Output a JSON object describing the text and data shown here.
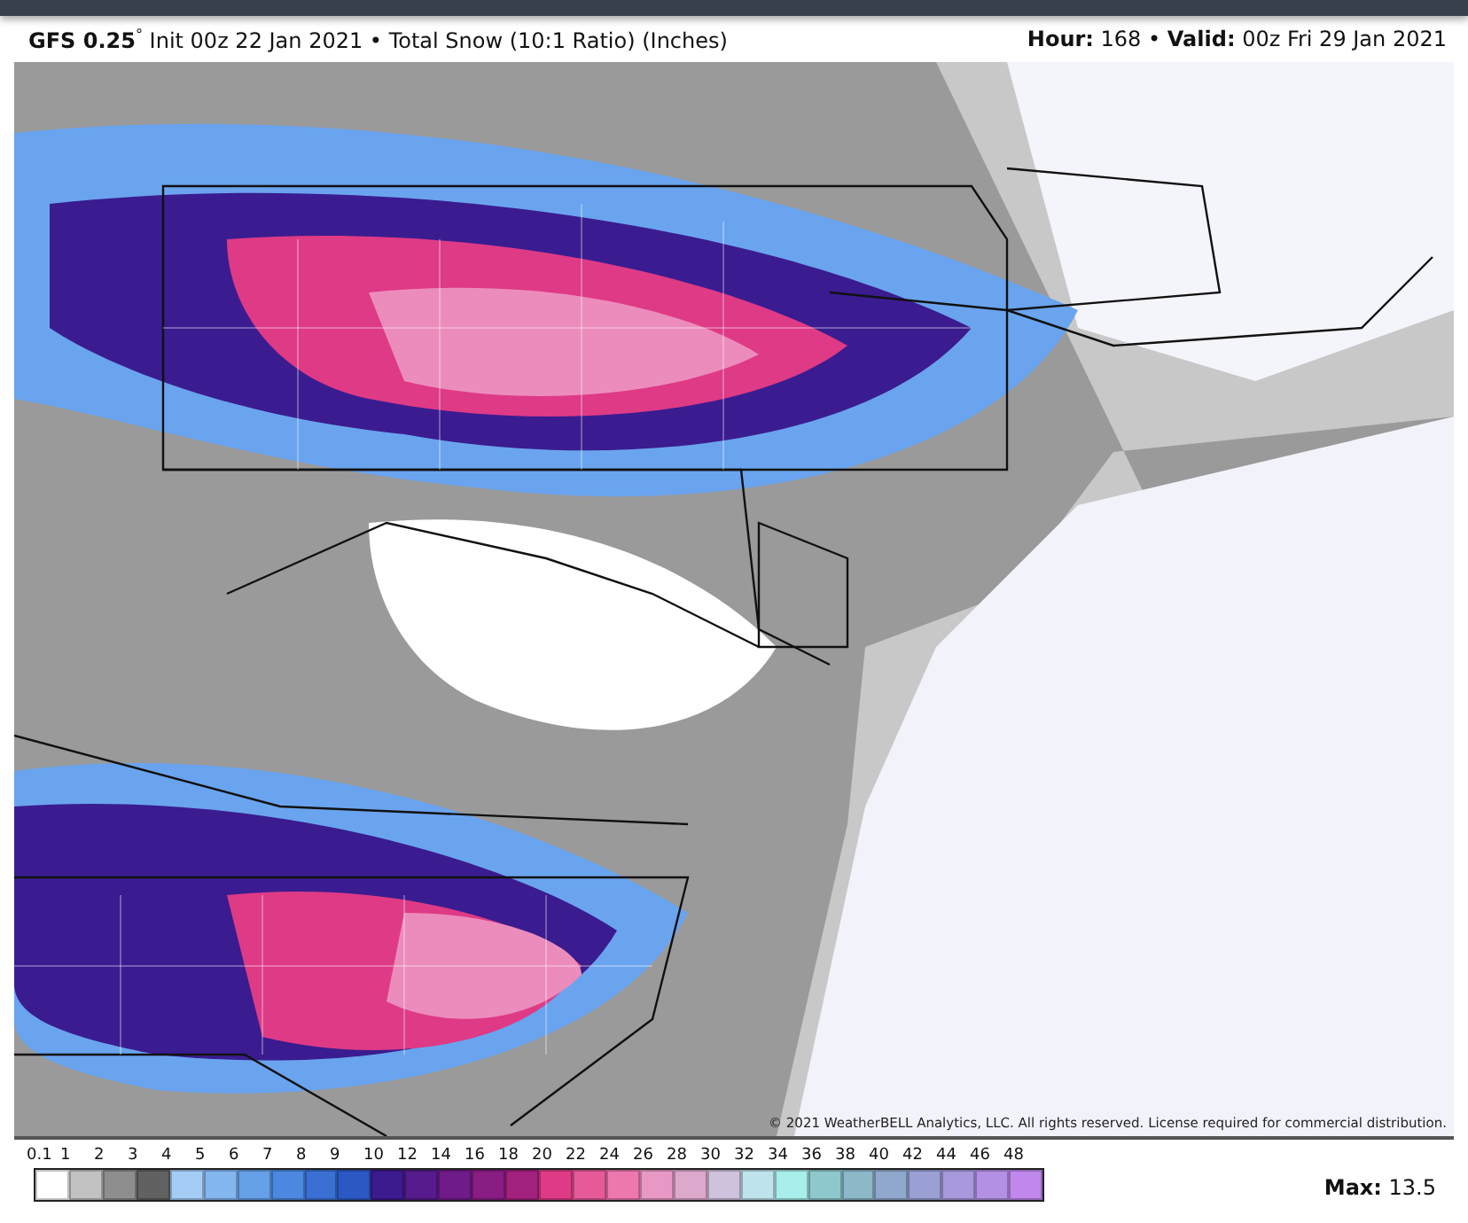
{
  "header": {
    "model": "GFS 0.25",
    "model_mark": "°",
    "init": "Init 00z 22 Jan 2021",
    "separator": "•",
    "product": "Total Snow (10:1 Ratio) (Inches)",
    "hour_label": "Hour:",
    "hour": "168",
    "valid_label": "Valid:",
    "valid": "00z Fri 29 Jan 2021"
  },
  "map": {
    "copyright": "© 2021 WeatherBELL Analytics, LLC. All rights reserved. License required for commercial distribution."
  },
  "legend": {
    "steps": [
      {
        "label": "0.1",
        "color": "#ffffff"
      },
      {
        "label": "1",
        "color": "#c2c2c2"
      },
      {
        "label": "2",
        "color": "#8e8e8e"
      },
      {
        "label": "3",
        "color": "#616161"
      },
      {
        "label": "4",
        "color": "#a4cdf6"
      },
      {
        "label": "5",
        "color": "#84b6f0"
      },
      {
        "label": "6",
        "color": "#65a0e8"
      },
      {
        "label": "7",
        "color": "#4c88e0"
      },
      {
        "label": "8",
        "color": "#3a70d4"
      },
      {
        "label": "9",
        "color": "#2c58c4"
      },
      {
        "label": "10",
        "color": "#3b1a8e"
      },
      {
        "label": "12",
        "color": "#561b8c"
      },
      {
        "label": "14",
        "color": "#6f1b8a"
      },
      {
        "label": "16",
        "color": "#891d84"
      },
      {
        "label": "18",
        "color": "#a3217e"
      },
      {
        "label": "20",
        "color": "#de3a86"
      },
      {
        "label": "22",
        "color": "#e65a9a"
      },
      {
        "label": "24",
        "color": "#ec78ae"
      },
      {
        "label": "26",
        "color": "#e898c4"
      },
      {
        "label": "28",
        "color": "#dca8cc"
      },
      {
        "label": "30",
        "color": "#cfc2dc"
      },
      {
        "label": "32",
        "color": "#bfe3ec"
      },
      {
        "label": "34",
        "color": "#a8eeea"
      },
      {
        "label": "36",
        "color": "#8ec8cc"
      },
      {
        "label": "38",
        "color": "#8cb8c8"
      },
      {
        "label": "40",
        "color": "#90a8cc"
      },
      {
        "label": "42",
        "color": "#9aa0d4"
      },
      {
        "label": "44",
        "color": "#a898dc"
      },
      {
        "label": "46",
        "color": "#b490e4"
      },
      {
        "label": "48",
        "color": "#c088ec"
      }
    ],
    "max_label": "Max:",
    "max_value": "13.5"
  }
}
